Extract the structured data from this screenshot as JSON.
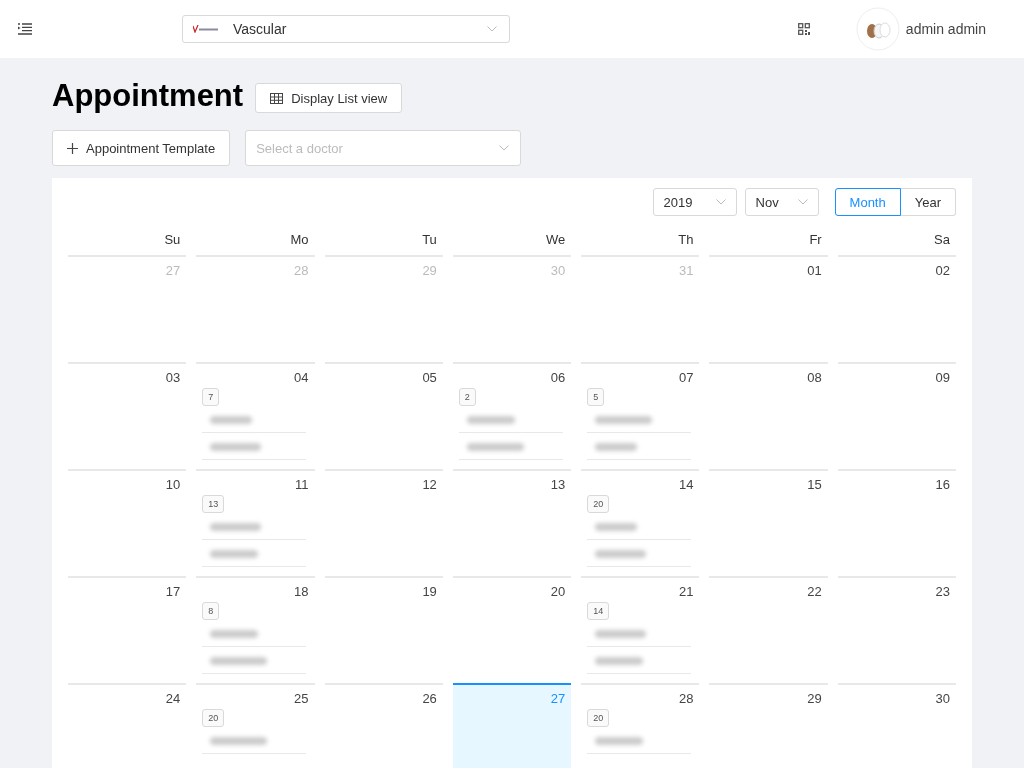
{
  "header": {
    "clinic": {
      "label": "Vascular"
    },
    "user": {
      "name": "admin admin"
    }
  },
  "page": {
    "title": "Appointment",
    "list_view_button": "Display List view",
    "template_button": "Appointment Template",
    "doctor_select": {
      "placeholder": "Select a doctor"
    }
  },
  "calendar": {
    "year": "2019",
    "month": "Nov",
    "modes": [
      {
        "label": "Month",
        "selected": true
      },
      {
        "label": "Year",
        "selected": false
      }
    ],
    "weekdays": [
      "Su",
      "Mo",
      "Tu",
      "We",
      "Th",
      "Fr",
      "Sa"
    ],
    "weeks": [
      [
        {
          "day": "27",
          "muted": true,
          "selected": false
        },
        {
          "day": "28",
          "muted": true,
          "selected": false
        },
        {
          "day": "29",
          "muted": true,
          "selected": false
        },
        {
          "day": "30",
          "muted": true,
          "selected": false
        },
        {
          "day": "31",
          "muted": true,
          "selected": false
        },
        {
          "day": "01",
          "muted": false,
          "selected": false
        },
        {
          "day": "02",
          "muted": false,
          "selected": false
        }
      ],
      [
        {
          "day": "03",
          "muted": false,
          "selected": false
        },
        {
          "day": "04",
          "muted": false,
          "selected": false,
          "count": "7",
          "entries": [
            {
              "kind": "blurred"
            },
            {
              "kind": "blurred"
            }
          ]
        },
        {
          "day": "05",
          "muted": false,
          "selected": false
        },
        {
          "day": "06",
          "muted": false,
          "selected": false,
          "count": "2",
          "entries": [
            {
              "kind": "blurred"
            },
            {
              "kind": "blurred"
            }
          ]
        },
        {
          "day": "07",
          "muted": false,
          "selected": false,
          "count": "5",
          "entries": [
            {
              "kind": "blurred"
            },
            {
              "kind": "blurred"
            }
          ]
        },
        {
          "day": "08",
          "muted": false,
          "selected": false
        },
        {
          "day": "09",
          "muted": false,
          "selected": false
        }
      ],
      [
        {
          "day": "10",
          "muted": false,
          "selected": false
        },
        {
          "day": "11",
          "muted": false,
          "selected": false,
          "count": "13",
          "entries": [
            {
              "kind": "blurred"
            },
            {
              "kind": "blurred"
            }
          ]
        },
        {
          "day": "12",
          "muted": false,
          "selected": false
        },
        {
          "day": "13",
          "muted": false,
          "selected": false
        },
        {
          "day": "14",
          "muted": false,
          "selected": false,
          "count": "20",
          "entries": [
            {
              "kind": "blurred"
            },
            {
              "kind": "blurred"
            }
          ]
        },
        {
          "day": "15",
          "muted": false,
          "selected": false
        },
        {
          "day": "16",
          "muted": false,
          "selected": false
        }
      ],
      [
        {
          "day": "17",
          "muted": false,
          "selected": false
        },
        {
          "day": "18",
          "muted": false,
          "selected": false,
          "count": "8",
          "entries": [
            {
              "kind": "blurred"
            },
            {
              "kind": "blurred"
            }
          ]
        },
        {
          "day": "19",
          "muted": false,
          "selected": false
        },
        {
          "day": "20",
          "muted": false,
          "selected": false
        },
        {
          "day": "21",
          "muted": false,
          "selected": false,
          "count": "14",
          "entries": [
            {
              "kind": "blurred"
            },
            {
              "kind": "blurred"
            }
          ]
        },
        {
          "day": "22",
          "muted": false,
          "selected": false
        },
        {
          "day": "23",
          "muted": false,
          "selected": false
        }
      ],
      [
        {
          "day": "24",
          "muted": false,
          "selected": false
        },
        {
          "day": "25",
          "muted": false,
          "selected": false,
          "count": "20",
          "entries": [
            {
              "kind": "blurred"
            }
          ]
        },
        {
          "day": "26",
          "muted": false,
          "selected": false
        },
        {
          "day": "27",
          "muted": false,
          "selected": true
        },
        {
          "day": "28",
          "muted": false,
          "selected": false,
          "count": "20",
          "entries": [
            {
              "kind": "blurred"
            }
          ]
        },
        {
          "day": "29",
          "muted": false,
          "selected": false
        },
        {
          "day": "30",
          "muted": false,
          "selected": false
        }
      ]
    ]
  }
}
